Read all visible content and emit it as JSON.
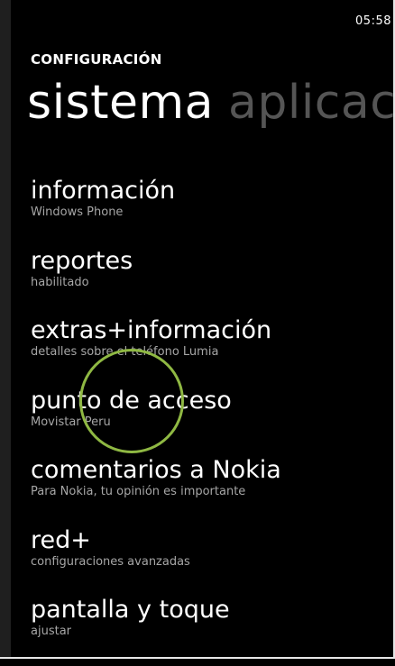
{
  "status": {
    "time": "05:58"
  },
  "header": {
    "section_label": "CONFIGURACIÓN"
  },
  "pivot": {
    "active": "sistema",
    "next": "aplicac"
  },
  "settings": [
    {
      "title": "información",
      "subtitle": "Windows Phone"
    },
    {
      "title": "reportes",
      "subtitle": "habilitado"
    },
    {
      "title": "extras+información",
      "subtitle": "detalles sobre el teléfono Lumia"
    },
    {
      "title": "punto de acceso",
      "subtitle": "Movistar Peru"
    },
    {
      "title": "comentarios a Nokia",
      "subtitle": "Para Nokia, tu opinión es importante"
    },
    {
      "title": "red+",
      "subtitle": "configuraciones avanzadas"
    },
    {
      "title": "pantalla y toque",
      "subtitle": "ajustar"
    }
  ],
  "colors": {
    "background": "#000000",
    "text": "#ffffff",
    "subtext": "#a6a6a6",
    "inactive_pivot": "#555555",
    "touch_indicator": "#8fb843"
  }
}
